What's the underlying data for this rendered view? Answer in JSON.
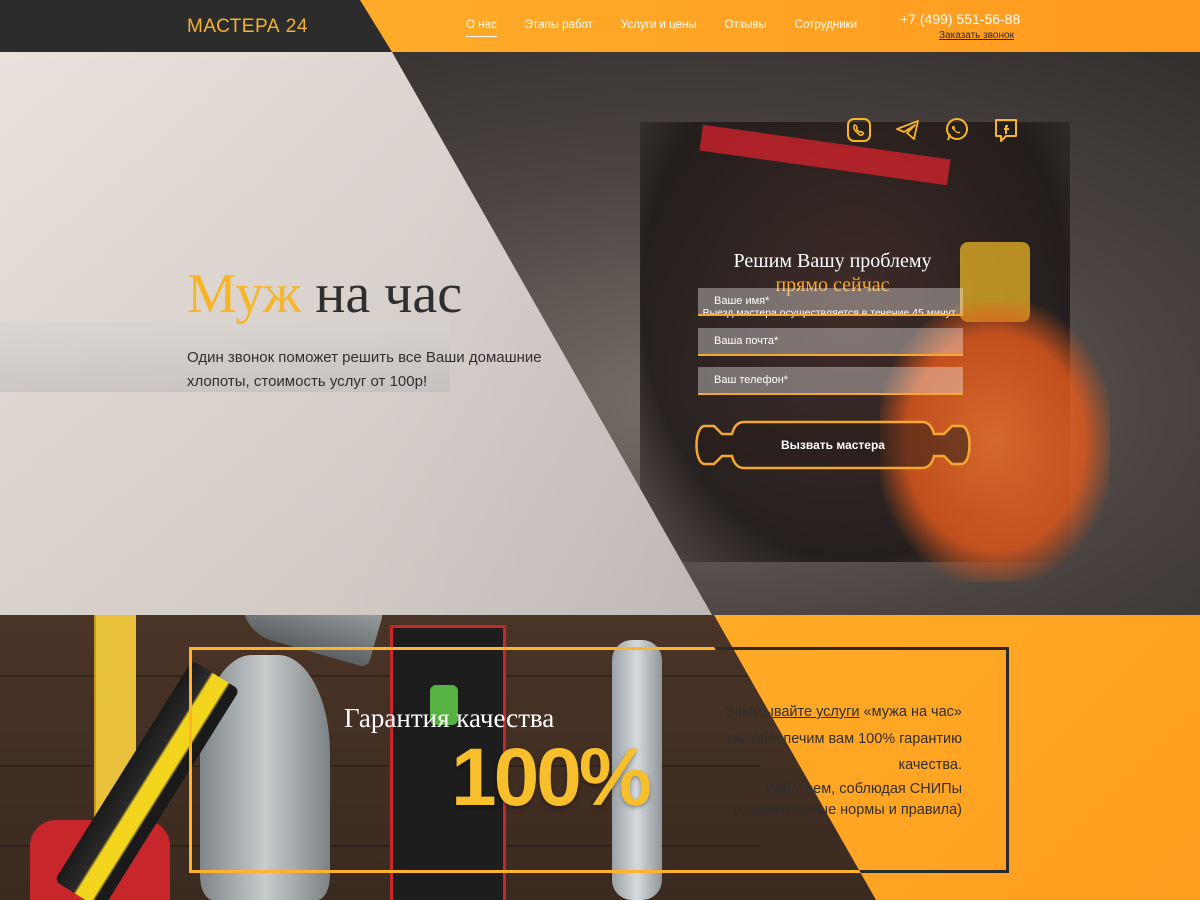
{
  "header": {
    "logo": "МАСТЕРА 24",
    "nav": [
      {
        "label": "О нас",
        "active": true
      },
      {
        "label": "Этапы работ",
        "active": false
      },
      {
        "label": "Услуги и цены",
        "active": false
      },
      {
        "label": "Отзывы",
        "active": false
      },
      {
        "label": "Сотрудники",
        "active": false
      }
    ],
    "phone": "+7 (499) 551-56-88",
    "callback": "Заказать звонок"
  },
  "hero": {
    "title_accent": "Муж",
    "title_rest": "на час",
    "subtitle": "Один звонок поможет решить все Ваши домашние хлопоты, стоимость услуг от 100р!",
    "social": [
      "viber-icon",
      "telegram-icon",
      "whatsapp-icon",
      "facebook-icon"
    ]
  },
  "form": {
    "title_line1": "Решим Вашу проблему",
    "title_line2": "прямо сейчас",
    "note": "Выезд мастера осуществляется в течение 45 минут.",
    "name_placeholder": "Ваше имя*",
    "email_placeholder": "Ваша почта*",
    "phone_placeholder": "Ваш телефон*",
    "submit": "Вызвать мастера"
  },
  "guarantee": {
    "title": "Гарантия качества",
    "percent": "100%",
    "text_link": "Заказывайте услуги",
    "text_after_link": " «мужа на час» мы обеспечим вам 100% гарантию качества.",
    "text2": "Работаем, соблюдая СНИПы (Строительные нормы и правила)"
  },
  "colors": {
    "accent": "#f7a730",
    "dark": "#2c2c2c",
    "orange": "#ffa321"
  }
}
